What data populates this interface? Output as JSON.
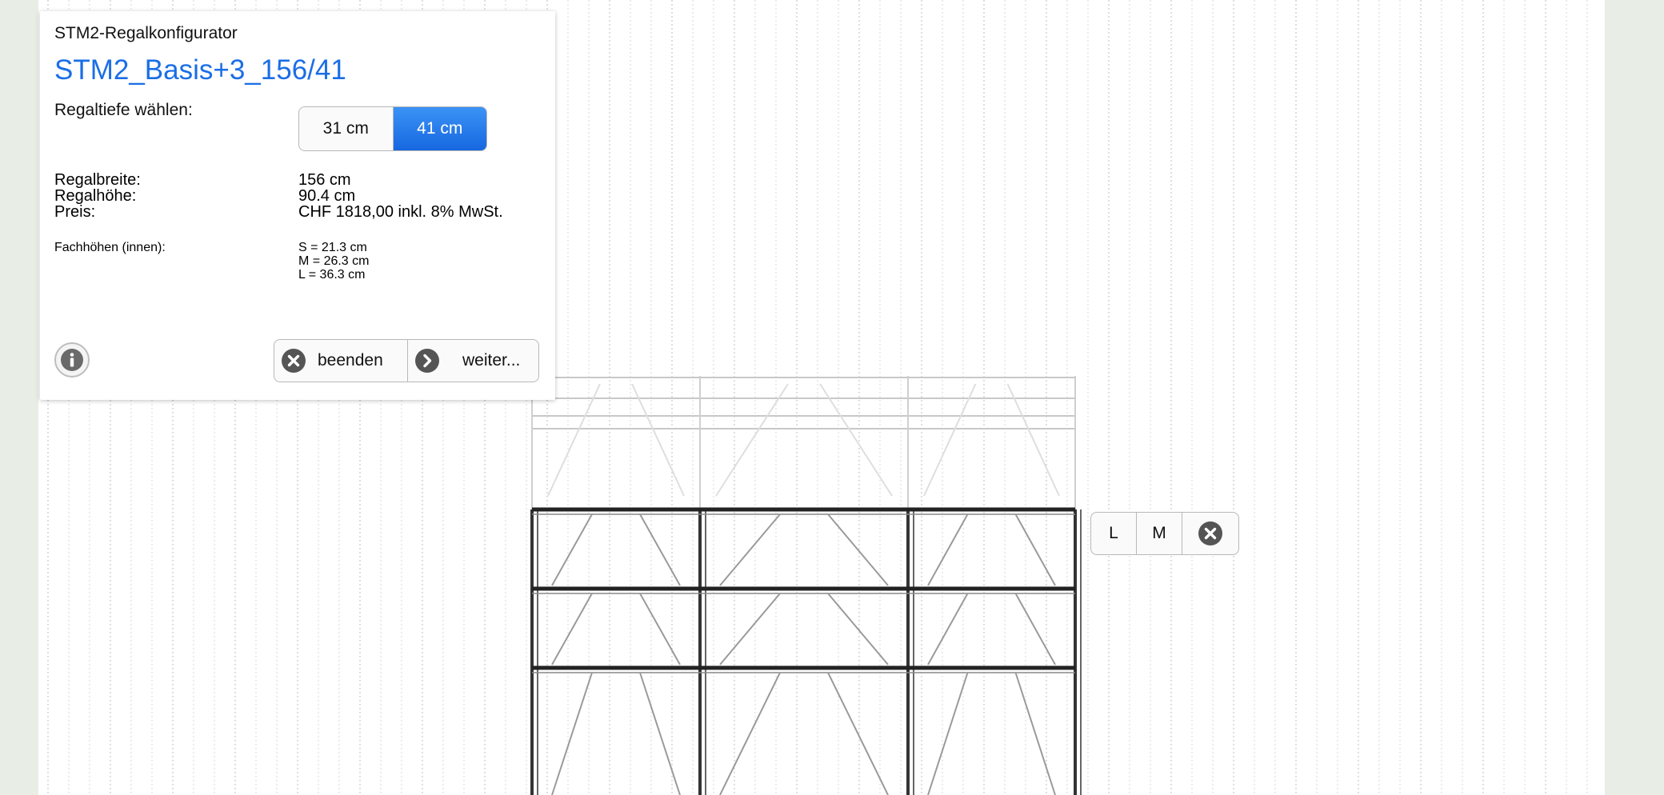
{
  "app": {
    "title": "STM2-Regalkonfigurator"
  },
  "config": {
    "name": "STM2_Basis+3_156/41"
  },
  "depth": {
    "label": "Regaltiefe wählen:",
    "options": [
      "31 cm",
      "41 cm"
    ],
    "selected": "41 cm"
  },
  "specs": {
    "width_label": "Regalbreite:",
    "width_value": "156 cm",
    "height_label": "Regalhöhe:",
    "height_value": "90.4 cm",
    "price_label": "Preis:",
    "price_value": "CHF 1818,00 inkl. 8% MwSt.",
    "compartments_label": "Fachhöhen (innen):",
    "compartment_s": "S = 21.3 cm",
    "compartment_m": "M = 26.3 cm",
    "compartment_l": "L = 36.3 cm"
  },
  "actions": {
    "quit_label": "beenden",
    "next_label": "weiter..."
  },
  "size_picker": {
    "l_label": "L",
    "m_label": "M"
  },
  "colors": {
    "accent": "#1a6ee6",
    "background": "#e8ede6",
    "canvas": "#ffffff"
  },
  "icons": [
    "info-icon",
    "close-circle-icon",
    "chevron-right-circle-icon"
  ]
}
